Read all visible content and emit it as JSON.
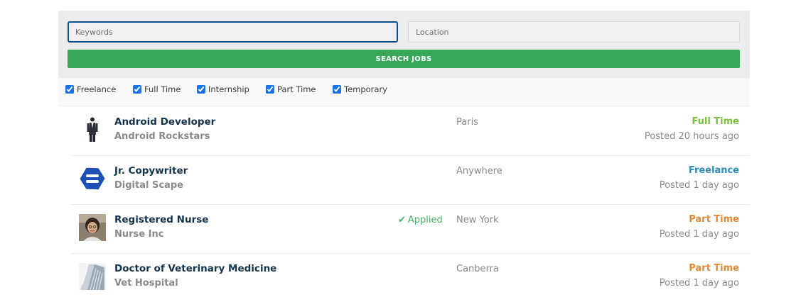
{
  "search": {
    "keywords_placeholder": "Keywords",
    "keywords_value": "",
    "location_placeholder": "Location",
    "location_value": "",
    "button_label": "SEARCH JOBS",
    "button_color": "#37a85a"
  },
  "filters": [
    {
      "label": "Freelance",
      "checked": true
    },
    {
      "label": "Full Time",
      "checked": true
    },
    {
      "label": "Internship",
      "checked": true
    },
    {
      "label": "Part Time",
      "checked": true
    },
    {
      "label": "Temporary",
      "checked": true
    }
  ],
  "jobs": [
    {
      "title": "Android Developer",
      "company": "Android Rockstars",
      "location": "Paris",
      "type": "Full Time",
      "type_color": "#7ac143",
      "posted": "Posted 20 hours ago",
      "applied": "",
      "logo_icon": "businessman-logo-icon"
    },
    {
      "title": "Jr. Copywriter",
      "company": "Digital Scape",
      "location": "Anywhere",
      "type": "Freelance",
      "type_color": "#2d8fc0",
      "posted": "Posted 1 day ago",
      "applied": "",
      "logo_icon": "digital-scape-logo-icon"
    },
    {
      "title": "Registered Nurse",
      "company": "Nurse Inc",
      "location": "New York",
      "type": "Part Time",
      "type_color": "#e08c3a",
      "posted": "Posted 1 day ago",
      "applied": "Applied",
      "logo_icon": "nurse-portrait-logo-icon"
    },
    {
      "title": "Doctor of Veterinary Medicine",
      "company": "Vet Hospital",
      "location": "Canberra",
      "type": "Part Time",
      "type_color": "#e08c3a",
      "posted": "Posted 1 day ago",
      "applied": "",
      "logo_icon": "building-logo-icon"
    }
  ]
}
